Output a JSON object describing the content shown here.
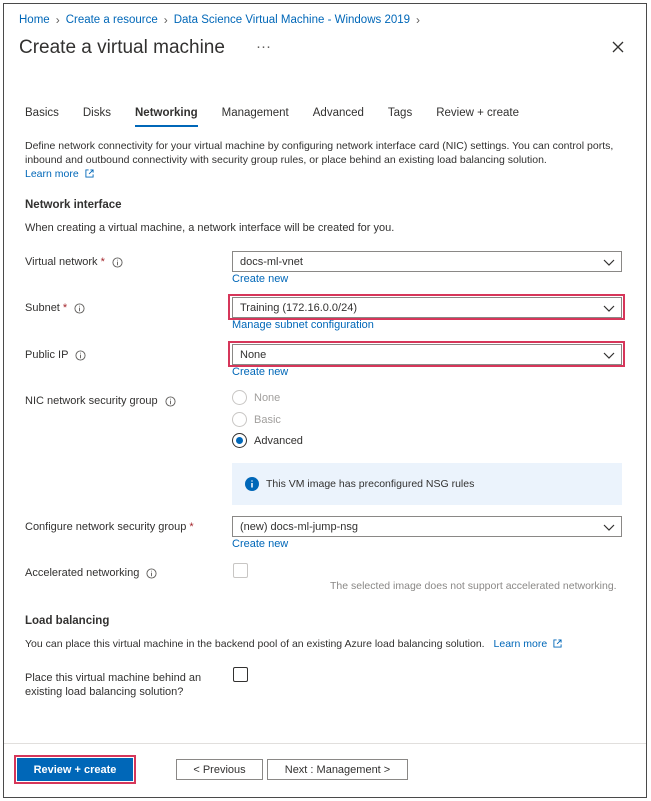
{
  "breadcrumb": [
    "Home",
    "Create a resource",
    "Data Science Virtual Machine - Windows 2019"
  ],
  "header": {
    "title": "Create a virtual machine",
    "more": "···"
  },
  "tabs": [
    "Basics",
    "Disks",
    "Networking",
    "Management",
    "Advanced",
    "Tags",
    "Review + create"
  ],
  "active_tab": "Networking",
  "description": {
    "text": "Define network connectivity for your virtual machine by configuring network interface card (NIC) settings. You can control ports, inbound and outbound connectivity with security group rules, or place behind an existing load balancing solution.",
    "learn_more": "Learn more"
  },
  "network_interface": {
    "heading": "Network interface",
    "intro": "When creating a virtual machine, a network interface will be created for you.",
    "virtual_network": {
      "label": "Virtual network",
      "value": "docs-ml-vnet",
      "link": "Create new"
    },
    "subnet": {
      "label": "Subnet",
      "value": "Training (172.16.0.0/24)",
      "link": "Manage subnet configuration"
    },
    "public_ip": {
      "label": "Public IP",
      "value": "None",
      "link": "Create new"
    },
    "nic_nsg": {
      "label": "NIC network security group",
      "options": [
        "None",
        "Basic",
        "Advanced"
      ],
      "selected": "Advanced"
    },
    "nsg_info": "This VM image has preconfigured NSG rules",
    "configure_nsg": {
      "label": "Configure network security group",
      "value": "(new) docs-ml-jump-nsg",
      "link": "Create new"
    },
    "accelerated": {
      "label": "Accelerated networking",
      "note": "The selected image does not support accelerated networking."
    }
  },
  "load_balancing": {
    "heading": "Load balancing",
    "intro": "You can place this virtual machine in the backend pool of an existing Azure load balancing solution.",
    "learn_more": "Learn more",
    "place_label_1": "Place this virtual machine behind an",
    "place_label_2": "existing load balancing solution?"
  },
  "footer": {
    "review": "Review + create",
    "previous": "< Previous",
    "next": "Next : Management >"
  },
  "colors": {
    "accent": "#0067b8",
    "highlight": "#d6365a",
    "required": "#a4262c"
  }
}
